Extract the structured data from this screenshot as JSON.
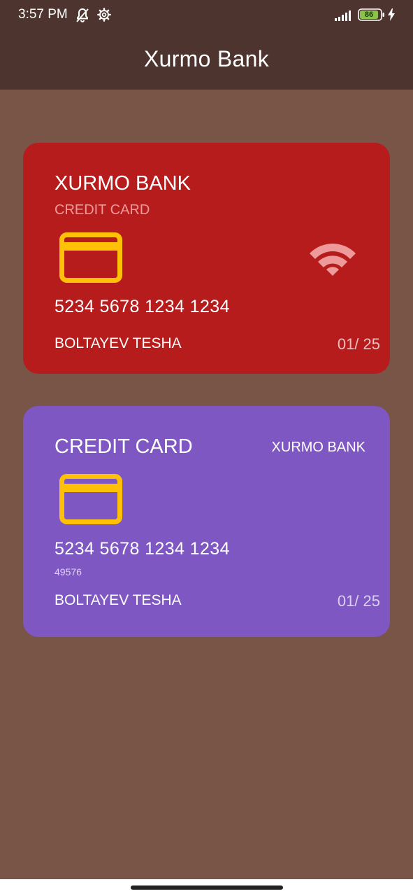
{
  "status_bar": {
    "time": "3:57 PM",
    "battery": "86",
    "icons": [
      "notifications-off-icon",
      "settings-gear-icon",
      "signal-icon",
      "battery-icon",
      "charging-bolt-icon"
    ]
  },
  "app_bar": {
    "title": "Xurmo Bank"
  },
  "cards": [
    {
      "bank_name": "XURMO BANK",
      "card_type": "CREDIT CARD",
      "number": "5234 5678 1234 1234",
      "holder": "BOLTAYEV TESHA",
      "expiry": "01/ 25",
      "background": "#b71c1c",
      "chip_color": "#ffc107",
      "icons": [
        "credit-card-icon",
        "contactless-wifi-icon"
      ]
    },
    {
      "card_type": "CREDIT CARD",
      "bank_name": "XURMO BANK",
      "number": "5234 5678 1234 1234",
      "cvv": "49576",
      "holder": "BOLTAYEV TESHA",
      "expiry": "01/ 25",
      "background": "#7e57c2",
      "chip_color": "#ffc107",
      "icons": [
        "credit-card-icon"
      ]
    }
  ],
  "colors": {
    "page_background": "#795548",
    "app_bar": "#4e342e",
    "battery_fill": "#8bc34a"
  }
}
